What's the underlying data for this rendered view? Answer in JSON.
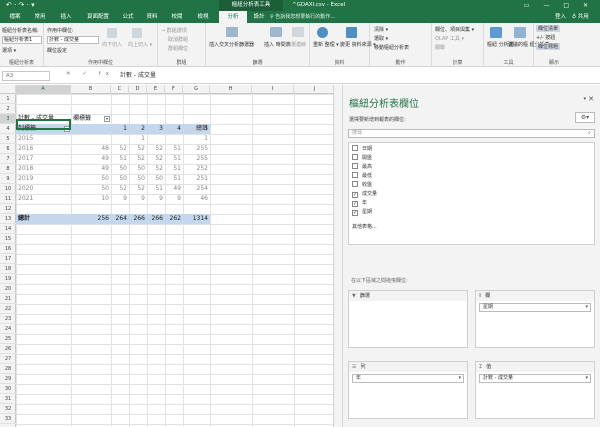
{
  "titlebar": {
    "quick_access": "↶ · ↷ · ▾",
    "context_tab": "樞紐分析表工具",
    "title": "^GDAXI.csv - Excel",
    "window_controls": "▭ — □ ✕"
  },
  "tabs": [
    "檔案",
    "常用",
    "插入",
    "頁面配置",
    "公式",
    "資料",
    "校閱",
    "檢視",
    "分析",
    "設計"
  ],
  "active_tab_index": 8,
  "tell_me": "♀ 告訴我您想要執行的動作...",
  "sign_in": "登入",
  "share": "♁ 共用",
  "ribbon": {
    "pivot_name_label": "樞紐分析表名稱:",
    "pivot_name": "樞紐分析表1",
    "options": "選項 ▾",
    "active_field_label": "作用中欄位:",
    "active_field": "計數 - 成交量",
    "field_settings": "欄位設定",
    "drill_down": "向下切入",
    "drill_up": "向上切入 ▾",
    "group_selection": "→ 群組選項",
    "ungroup": "取消群組",
    "group_field": "群組欄位",
    "insert_slicer": "插入交叉分析篩選器",
    "insert_timeline": "插入 時間表",
    "filter_connections": "篩選連線",
    "refresh": "重新 整理 ▾",
    "change_source": "變更 資料來源 ▾",
    "clear": "清除 ▾",
    "select": "選取 ▾",
    "move_pivot": "移動樞紐分析表",
    "fields_items": "欄位、項目與集 ▾",
    "olap_tools": "OLAP 工具 ▾",
    "relationships": "關聯",
    "pivot_chart": "樞紐 分析圖",
    "recommended": "建議的樞 紐分析表",
    "field_list": "欄位清單",
    "buttons": "+/- 按鈕",
    "field_headers": "欄位標題",
    "groups": {
      "pivot": "樞紐分析表",
      "active_field": "作用中欄位",
      "group": "群組",
      "filter": "篩選",
      "data": "資料",
      "actions": "動作",
      "calculations": "計算",
      "tools": "工具",
      "show": "顯示"
    }
  },
  "formula_bar": {
    "name_box": "A3",
    "fx_symbols": "✕ ✓ fx",
    "content": "計數 - 成交量"
  },
  "columns": [
    "A",
    "B",
    "C",
    "D",
    "E",
    "F",
    "G",
    "H",
    "I",
    "J",
    "K"
  ],
  "rows": [
    "1",
    "2",
    "3",
    "4",
    "5",
    "6",
    "7",
    "8",
    "9",
    "10",
    "11",
    "12",
    "13",
    "14",
    "15",
    "16",
    "17",
    "18",
    "19",
    "20",
    "21",
    "22",
    "23",
    "24",
    "25",
    "26",
    "27",
    "28",
    "29",
    "30",
    "31",
    "32",
    "33"
  ],
  "pivot": {
    "value_label": "計數 - 成交量",
    "col_label": "欄標籤",
    "row_label": "列標籤",
    "col_values": [
      "1",
      "2",
      "3",
      "4",
      "5"
    ],
    "grand_total_label": "總計",
    "body": [
      {
        "year": "2015",
        "values": [
          "",
          "",
          "1",
          "",
          ""
        ],
        "total": "1"
      },
      {
        "year": "2016",
        "values": [
          "48",
          "52",
          "52",
          "52",
          "51"
        ],
        "total": "255"
      },
      {
        "year": "2017",
        "values": [
          "49",
          "51",
          "52",
          "52",
          "51"
        ],
        "total": "255"
      },
      {
        "year": "2018",
        "values": [
          "49",
          "50",
          "50",
          "52",
          "51"
        ],
        "total": "252"
      },
      {
        "year": "2019",
        "values": [
          "50",
          "50",
          "50",
          "50",
          "51"
        ],
        "total": "251"
      },
      {
        "year": "2020",
        "values": [
          "50",
          "52",
          "52",
          "51",
          "49"
        ],
        "total": "254"
      },
      {
        "year": "2021",
        "values": [
          "10",
          "9",
          "9",
          "9",
          "9"
        ],
        "total": "46"
      }
    ],
    "totals": [
      "256",
      "264",
      "266",
      "266",
      "262"
    ],
    "grand_total": "1314"
  },
  "pane": {
    "title": "樞紐分析表欄位",
    "subtitle": "選擇要新增到報表的欄位:",
    "search_placeholder": "搜尋",
    "fields": [
      {
        "name": "日期",
        "checked": false
      },
      {
        "name": "開盤",
        "checked": false
      },
      {
        "name": "最高",
        "checked": false
      },
      {
        "name": "最低",
        "checked": false
      },
      {
        "name": "收盤",
        "checked": false
      },
      {
        "name": "成交量",
        "checked": true
      },
      {
        "name": "年",
        "checked": true
      },
      {
        "name": "星期",
        "checked": true
      }
    ],
    "more_tables": "其他表格...",
    "drag_hint": "在以下區域之間拖曳欄位:",
    "areas": {
      "filters": {
        "label": "篩選",
        "items": []
      },
      "columns": {
        "label": "欄",
        "items": [
          "星期"
        ]
      },
      "rows": {
        "label": "列",
        "items": [
          "年"
        ]
      },
      "values": {
        "label": "值",
        "items": [
          "計數 - 成交量"
        ]
      }
    }
  },
  "colors": {
    "excel_green": "#217346",
    "pivot_band": "#dde8f4",
    "pivot_header": "#c5d7ec"
  }
}
